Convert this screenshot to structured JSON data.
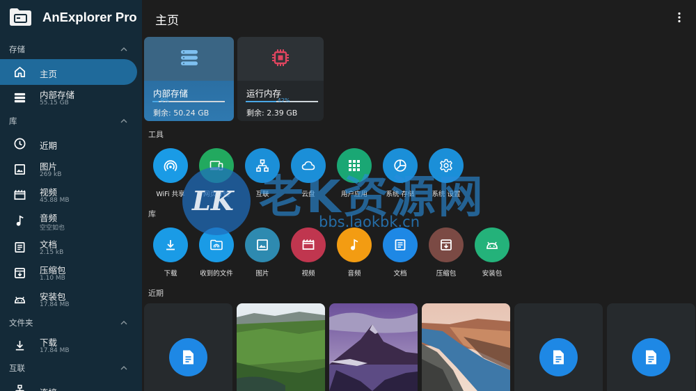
{
  "app": {
    "title": "AnExplorer Pro"
  },
  "sidebar": {
    "sections": [
      {
        "label": "存储"
      },
      {
        "label": "库"
      },
      {
        "label": "文件夹"
      },
      {
        "label": "互联"
      }
    ],
    "items": [
      {
        "label": "主页",
        "sub": "",
        "icon": "home-icon",
        "active": true
      },
      {
        "label": "内部存储",
        "sub": "55.15 GB",
        "icon": "storage-icon"
      },
      {
        "label": "近期",
        "sub": "",
        "icon": "clock-icon"
      },
      {
        "label": "图片",
        "sub": "269 kB",
        "icon": "image-icon"
      },
      {
        "label": "视频",
        "sub": "45.88 MB",
        "icon": "video-icon"
      },
      {
        "label": "音频",
        "sub": "空空如也",
        "icon": "music-icon"
      },
      {
        "label": "文档",
        "sub": "2.15 kB",
        "icon": "document-icon"
      },
      {
        "label": "压缩包",
        "sub": "1.10 MB",
        "icon": "archive-icon"
      },
      {
        "label": "安装包",
        "sub": "17.84 MB",
        "icon": "android-icon"
      },
      {
        "label": "下载",
        "sub": "17.84 MB",
        "icon": "download-icon"
      },
      {
        "label": "连接",
        "sub": "",
        "icon": "connection-icon"
      }
    ]
  },
  "main": {
    "title": "主页",
    "storage_cards": [
      {
        "title": "内部存储",
        "percent_label": "9%",
        "percent": 9,
        "free": "剩余: 50.24 GB",
        "icon": "storage-icon"
      },
      {
        "title": "运行内存",
        "percent_label": "42%",
        "percent": 42,
        "free": "剩余: 2.39 GB",
        "icon": "memory-chip-icon"
      }
    ],
    "tools_label": "工具",
    "tools": [
      {
        "label": "WiFi 共享",
        "color": "#1a9be6",
        "icon": "wifi-share-icon"
      },
      {
        "label": "网页传输",
        "color": "#22a95f",
        "icon": "web-transfer-icon"
      },
      {
        "label": "互联",
        "color": "#1b8fd8",
        "icon": "network-icon"
      },
      {
        "label": "云盘",
        "color": "#1b8fd8",
        "icon": "cloud-icon"
      },
      {
        "label": "用户应用",
        "color": "#1aa774",
        "icon": "apps-grid-icon"
      },
      {
        "label": "系统 存储",
        "color": "#1b8fd8",
        "icon": "pie-chart-icon"
      },
      {
        "label": "系统 设置",
        "color": "#1b8fd8",
        "icon": "settings-icon"
      }
    ],
    "library_label": "库",
    "library": [
      {
        "label": "下载",
        "color": "#1a9be6",
        "icon": "download-icon"
      },
      {
        "label": "收到的文件",
        "color": "#1a9be6",
        "icon": "received-folder-icon"
      },
      {
        "label": "图片",
        "color": "#2e8ab0",
        "icon": "image-icon"
      },
      {
        "label": "视频",
        "color": "#c0364f",
        "icon": "video-icon"
      },
      {
        "label": "音频",
        "color": "#f39c12",
        "icon": "music-icon"
      },
      {
        "label": "文档",
        "color": "#1e88e5",
        "icon": "document-icon"
      },
      {
        "label": "压缩包",
        "color": "#7b4a44",
        "icon": "archive-icon"
      },
      {
        "label": "安装包",
        "color": "#24b27a",
        "icon": "android-icon"
      }
    ],
    "recent_label": "近期"
  },
  "watermark": {
    "logo": "LK",
    "text": "老K资源网",
    "url": "bbs.laokbk.cn"
  }
}
